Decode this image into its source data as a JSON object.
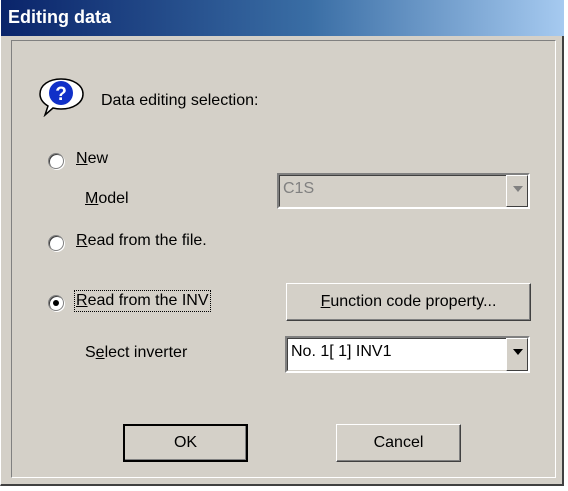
{
  "window": {
    "title": "Editing data"
  },
  "prompt": {
    "label": "Data editing selection:"
  },
  "options": {
    "new_label": "New",
    "new_accel": "N",
    "new_rest": "ew",
    "model_accel": "M",
    "model_rest": "odel",
    "model_value": "C1S",
    "read_file_accel": "R",
    "read_file_rest": "ead from the file.",
    "read_inv_accel": "R",
    "read_inv_rest": "ead from the INV",
    "selected": "read_inv"
  },
  "function_code": {
    "accel": "F",
    "rest": "unction code property..."
  },
  "inverter": {
    "label_pre": "S",
    "label_accel": "e",
    "label_rest": "lect inverter",
    "value": "No. 1[ 1] INV1"
  },
  "buttons": {
    "ok": "OK",
    "cancel": "Cancel"
  },
  "colors": {
    "title_start": "#0a246a",
    "title_end": "#a6caf0",
    "face": "#d4d0c8"
  },
  "icons": {
    "prompt_icon": "question-icon"
  }
}
